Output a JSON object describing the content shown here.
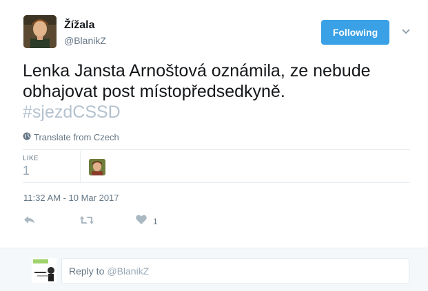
{
  "author": {
    "name": "Žížala",
    "handle": "@BlanikZ"
  },
  "follow_button": {
    "label": "Following",
    "color": "#3ba1e6"
  },
  "tweet": {
    "text_line1": "Lenka Jansta Arnoštová oznámila, ze nebude",
    "text_line2": "obhajovat post místopředsedkyně.",
    "hashtag": "#sjezdCSSD",
    "translate_label": "Translate from Czech"
  },
  "stats": {
    "like_label": "LIKE",
    "like_count": "1"
  },
  "timestamp": "11:32 AM - 10 Mar 2017",
  "actions": {
    "reply_icon": "reply-icon",
    "retweet_icon": "retweet-icon",
    "like_icon": "heart-icon",
    "like_count": "1"
  },
  "reply_box": {
    "prefix": "Reply to",
    "mention": "@BlanikZ"
  }
}
